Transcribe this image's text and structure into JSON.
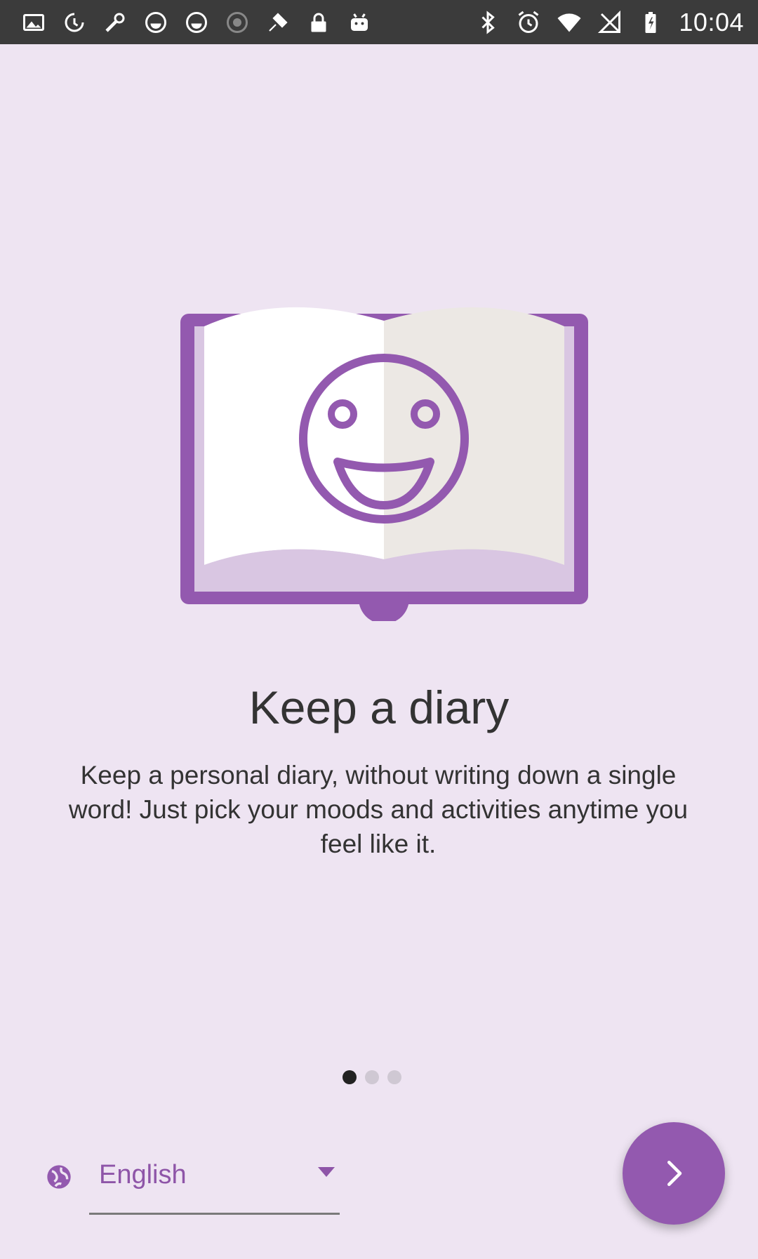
{
  "status_bar": {
    "time": "10:04",
    "left_icons": [
      "image-icon",
      "sync-icon",
      "tools-icon",
      "circle-icon",
      "circle-icon",
      "target-icon",
      "fake-gps-icon",
      "lock-icon",
      "android-icon"
    ],
    "right_icons": [
      "bluetooth-icon",
      "alarm-icon",
      "wifi-icon",
      "no-signal-icon",
      "battery-icon"
    ]
  },
  "onboarding": {
    "illustration": "smiling-open-book",
    "title": "Keep a diary",
    "description": "Keep a personal diary, without writing down a single word! Just pick your moods and activities anytime you feel like it.",
    "page_indicator": {
      "total": 3,
      "active": 0
    }
  },
  "language": {
    "selected": "English",
    "icon": "globe-icon"
  },
  "next_button": {
    "icon": "chevron-right-icon"
  },
  "colors": {
    "background": "#EEE4F2",
    "accent": "#9359AF",
    "status_bar": "#3b3b3b",
    "text": "#333333"
  }
}
